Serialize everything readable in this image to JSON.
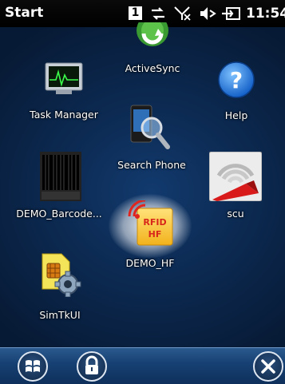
{
  "status_bar": {
    "title": "Start",
    "notification_count": "1",
    "clock": "11:54",
    "icons": [
      "sync-icon",
      "no-signal-icon",
      "volume-muted-icon",
      "power-plug-icon"
    ]
  },
  "apps": [
    {
      "id": "activesync",
      "label": "ActiveSync",
      "icon": "activesync-icon"
    },
    {
      "id": "help",
      "label": "Help",
      "icon": "help-icon"
    },
    {
      "id": "task_manager",
      "label": "Task Manager",
      "icon": "task-manager-icon"
    },
    {
      "id": "search_phone",
      "label": "Search Phone",
      "icon": "search-phone-icon"
    },
    {
      "id": "demo_barcode",
      "label": "DEMO_Barcode...",
      "icon": "barcode-icon"
    },
    {
      "id": "scu",
      "label": "scu",
      "icon": "scu-icon"
    },
    {
      "id": "demo_hf",
      "label": "DEMO_HF",
      "icon": "rfid-hf-icon"
    },
    {
      "id": "simtkui",
      "label": "SimTkUI",
      "icon": "sim-toolkit-icon"
    }
  ],
  "rfid_icon_text": {
    "line1": "RFID",
    "line2": "HF"
  },
  "bottom_bar": {
    "buttons": [
      "start-button",
      "lock-button",
      "close-button"
    ]
  }
}
